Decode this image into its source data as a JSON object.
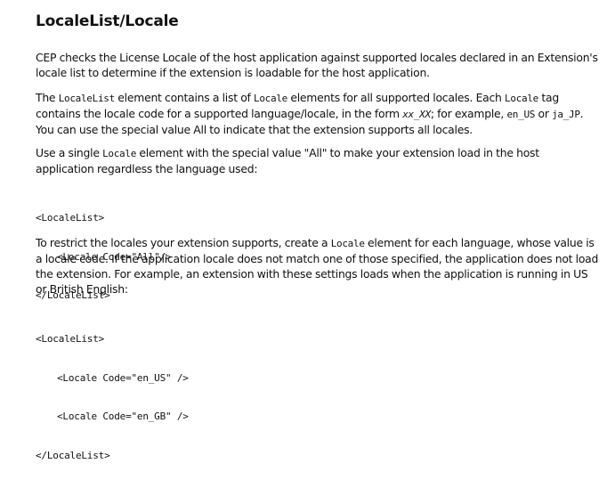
{
  "heading": "LocaleList/Locale",
  "p1": {
    "line1": "CEP checks the License Locale of the host application against supported locales declared in an Extension's",
    "line2": "locale list to determine if the extension is loadable for the host application."
  },
  "p2": {
    "l1a": "The ",
    "l1b": "LocaleList",
    "l1c": " element contains a list of ",
    "l1d": "Locale",
    "l1e": " elements for all supported locales. Each ",
    "l1f": "Locale",
    "l1g": " tag",
    "l2a": "contains the locale code for a supported language/locale, in the form ",
    "l2b": "xx_XX",
    "l2c": "; for example, ",
    "l2d": "en_US",
    "l2e": " or ",
    "l2f": "ja_JP",
    "l2g": ".",
    "l3": "You can use the special value All to indicate that the extension supports all locales."
  },
  "p3": {
    "l1a": "Use a single ",
    "l1b": "Locale",
    "l1c": " element with the special value \"All\" to make your extension load in the host",
    "l2": "application regardless the language used:"
  },
  "code1": {
    "open": "<LocaleList>",
    "item": "<Locale Code=\"All\"/>",
    "close": "</LocaleList>"
  },
  "p4": {
    "l1a": "To restrict the locales your extension supports, create a ",
    "l1b": "Locale",
    "l1c": " element for each language, whose value is",
    "l2": "a locale code. If the application locale does not match one of those specified, the application does not load",
    "l3": "the extension. For example, an extension with these settings loads when the application is running in US",
    "l4": "or British English:"
  },
  "code2": {
    "open": "<LocaleList>",
    "item1": "<Locale Code=\"en_US\" />",
    "item2": "<Locale Code=\"en_GB\" />",
    "close": "</LocaleList>"
  }
}
